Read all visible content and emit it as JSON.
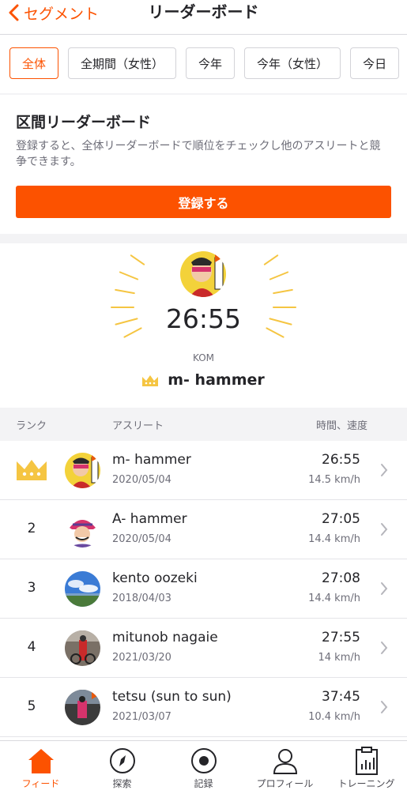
{
  "header": {
    "back_label": "セグメント",
    "title": "リーダーボード"
  },
  "filters": [
    "全体",
    "全期間（女性）",
    "今年",
    "今年（女性）",
    "今日"
  ],
  "signup_card": {
    "title": "区間リーダーボード",
    "text": "登録すると、全体リーダーボードで順位をチェックし他のアスリートと競争できます。",
    "button": "登録する"
  },
  "hero": {
    "time": "26:55",
    "label": "KOM",
    "name": "m- hammer"
  },
  "table": {
    "headers": {
      "rank": "ランク",
      "athlete": "アスリート",
      "time": "時間、速度"
    },
    "rows": [
      {
        "rank": "",
        "crown": true,
        "name": "m- hammer",
        "date": "2020/05/04",
        "time": "26:55",
        "speed": "14.5 km/h"
      },
      {
        "rank": "2",
        "crown": false,
        "name": "A- hammer",
        "date": "2020/05/04",
        "time": "27:05",
        "speed": "14.4 km/h"
      },
      {
        "rank": "3",
        "crown": false,
        "name": "kento oozeki",
        "date": "2018/04/03",
        "time": "27:08",
        "speed": "14.4 km/h"
      },
      {
        "rank": "4",
        "crown": false,
        "name": "mitunob nagaie",
        "date": "2021/03/20",
        "time": "27:55",
        "speed": "14 km/h"
      },
      {
        "rank": "5",
        "crown": false,
        "name": "tetsu (sun to sun)",
        "date": "2021/03/07",
        "time": "37:45",
        "speed": "10.4 km/h"
      }
    ]
  },
  "tabs": [
    {
      "label": "フィード",
      "icon": "home-icon",
      "active": true
    },
    {
      "label": "探索",
      "icon": "compass-icon",
      "active": false
    },
    {
      "label": "記録",
      "icon": "record-icon",
      "active": false
    },
    {
      "label": "プロフィール",
      "icon": "profile-icon",
      "active": false
    },
    {
      "label": "トレーニング",
      "icon": "training-icon",
      "active": false
    }
  ],
  "colors": {
    "accent": "#fc5200",
    "crown": "#f5c542",
    "text": "#242428",
    "muted": "#6d6d78"
  }
}
